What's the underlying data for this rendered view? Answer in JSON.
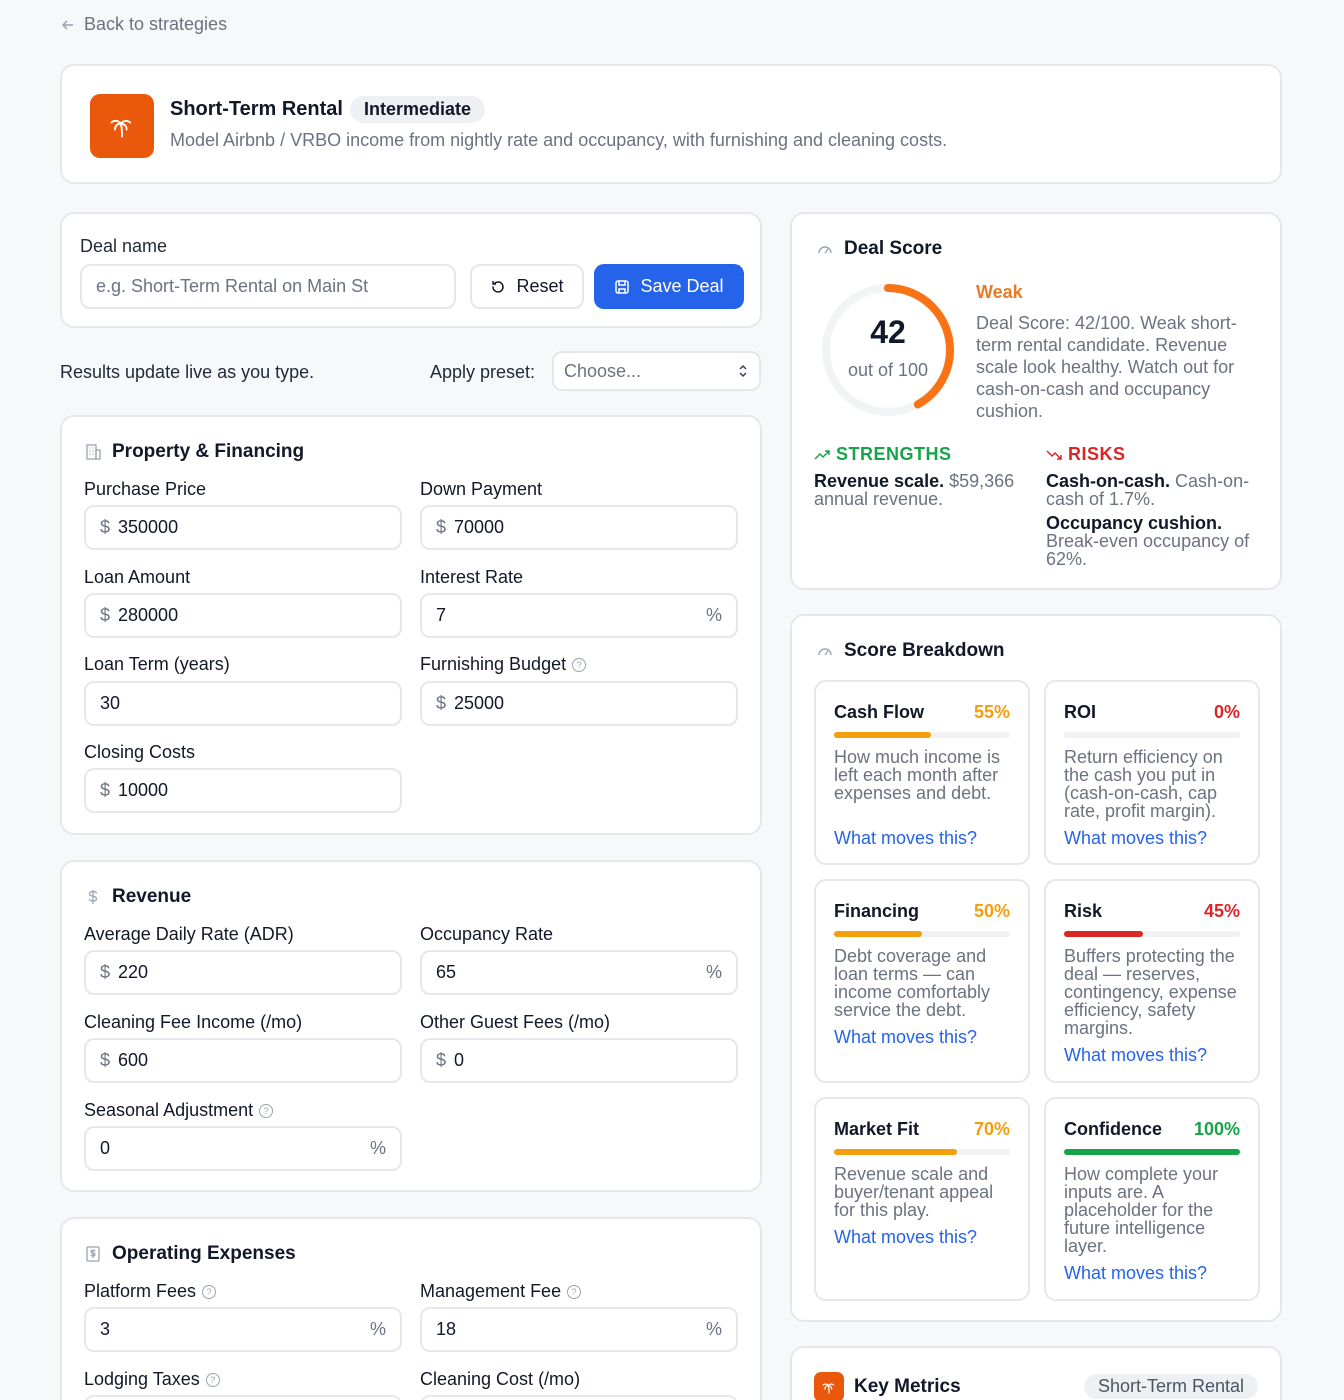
{
  "nav": {
    "back_label": "Back to strategies"
  },
  "strategy": {
    "title": "Short-Term Rental",
    "level": "Intermediate",
    "description": "Model Airbnb / VRBO income from nightly rate and occupancy, with furnishing and cleaning costs.",
    "icon": "palm-tree-icon",
    "accent": "#ea580c"
  },
  "deal": {
    "name_label": "Deal name",
    "name_placeholder": "e.g. Short-Term Rental on Main St",
    "reset_label": "Reset",
    "save_label": "Save Deal"
  },
  "live_note": "Results update live as you type.",
  "preset": {
    "label": "Apply preset:",
    "value": "Choose..."
  },
  "property": {
    "title": "Property & Financing",
    "purchase_price": {
      "label": "Purchase Price",
      "prefix": "$",
      "value": "350000"
    },
    "down_payment": {
      "label": "Down Payment",
      "prefix": "$",
      "value": "70000"
    },
    "loan_amount": {
      "label": "Loan Amount",
      "prefix": "$",
      "value": "280000"
    },
    "interest_rate": {
      "label": "Interest Rate",
      "value": "7",
      "suffix": "%"
    },
    "loan_term": {
      "label": "Loan Term (years)",
      "value": "30"
    },
    "furnishing_budget": {
      "label": "Furnishing Budget",
      "prefix": "$",
      "value": "25000"
    },
    "closing_costs": {
      "label": "Closing Costs",
      "prefix": "$",
      "value": "10000"
    }
  },
  "revenue": {
    "title": "Revenue",
    "adr": {
      "label": "Average Daily Rate (ADR)",
      "prefix": "$",
      "value": "220"
    },
    "occupancy": {
      "label": "Occupancy Rate",
      "value": "65",
      "suffix": "%"
    },
    "cleaning_fee_income": {
      "label": "Cleaning Fee Income (/mo)",
      "prefix": "$",
      "value": "600"
    },
    "other_guest_fees": {
      "label": "Other Guest Fees (/mo)",
      "prefix": "$",
      "value": "0"
    },
    "seasonal_adjustment": {
      "label": "Seasonal Adjustment",
      "value": "0",
      "suffix": "%"
    }
  },
  "expenses": {
    "title": "Operating Expenses",
    "platform_fees": {
      "label": "Platform Fees",
      "value": "3",
      "suffix": "%"
    },
    "management_fee": {
      "label": "Management Fee",
      "value": "18",
      "suffix": "%"
    },
    "lodging_taxes": {
      "label": "Lodging Taxes"
    },
    "cleaning_cost": {
      "label": "Cleaning Cost (/mo)"
    }
  },
  "deal_score": {
    "title": "Deal Score",
    "score": 42,
    "max": 100,
    "score_label": "42",
    "out_of": "out of 100",
    "verdict": "Weak",
    "summary": "Deal Score: 42/100. Weak short-term rental candidate. Revenue scale look healthy. Watch out for cash-on-cash and occupancy cushion.",
    "strengths_label": "STRENGTHS",
    "risks_label": "RISKS",
    "strengths": [
      {
        "title": "Revenue scale.",
        "text": "$59,366 annual revenue."
      }
    ],
    "risks": [
      {
        "title": "Cash-on-cash.",
        "text": "Cash-on-cash of 1.7%."
      },
      {
        "title": "Occupancy cushion.",
        "text": "Break-even occupancy of 62%."
      }
    ]
  },
  "breakdown": {
    "title": "Score Breakdown",
    "link_label": "What moves this?",
    "items": [
      {
        "name": "Cash Flow",
        "pct_label": "55%",
        "pct": 55,
        "color": "#f59e0b",
        "desc": "How much income is left each month after expenses and debt."
      },
      {
        "name": "ROI",
        "pct_label": "0%",
        "pct": 0,
        "color": "#dc2626",
        "desc": "Return efficiency on the cash you put in (cash-on-cash, cap rate, profit margin)."
      },
      {
        "name": "Financing",
        "pct_label": "50%",
        "pct": 50,
        "color": "#f59e0b",
        "desc": "Debt coverage and loan terms — can income comfortably service the debt."
      },
      {
        "name": "Risk",
        "pct_label": "45%",
        "pct": 45,
        "color": "#dc2626",
        "desc": "Buffers protecting the deal — reserves, contingency, expense efficiency, safety margins."
      },
      {
        "name": "Market Fit",
        "pct_label": "70%",
        "pct": 70,
        "color": "#f59e0b",
        "desc": "Revenue scale and buyer/tenant appeal for this play."
      },
      {
        "name": "Confidence",
        "pct_label": "100%",
        "pct": 100,
        "color": "#16a34a",
        "desc": "How complete your inputs are. A placeholder for the future intelligence layer."
      }
    ]
  },
  "key_metrics": {
    "title": "Key Metrics",
    "badge": "Short-Term Rental"
  },
  "colors": {
    "primary": "#2563eb",
    "success": "#16a34a",
    "danger": "#dc2626",
    "warning": "#f59e0b",
    "orange": "#ea580c"
  }
}
